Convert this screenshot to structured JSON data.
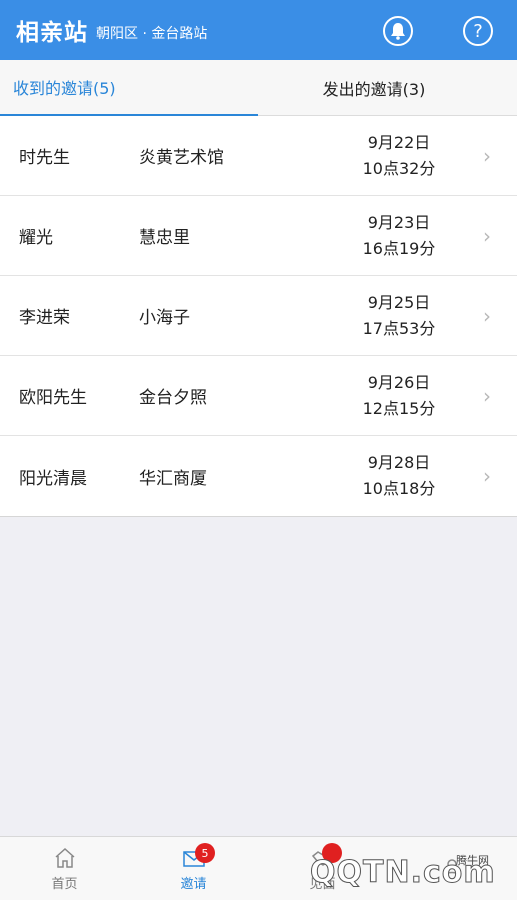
{
  "header": {
    "title": "相亲站",
    "location": "朝阳区 · 金台路站",
    "bell_icon": "bell-icon",
    "help_icon": "question-mark-icon",
    "help_glyph": "?"
  },
  "tabs": [
    {
      "label": "收到的邀请(5)",
      "active": true
    },
    {
      "label": "发出的邀请(3)",
      "active": false
    }
  ],
  "invitations": [
    {
      "name": "时先生",
      "place": "炎黄艺术馆",
      "date": "9月22日",
      "time": "10点32分"
    },
    {
      "name": "耀光",
      "place": "慧忠里",
      "date": "9月23日",
      "time": "16点19分"
    },
    {
      "name": "李进荣",
      "place": "小海子",
      "date": "9月25日",
      "time": "17点53分"
    },
    {
      "name": "欧阳先生",
      "place": "金台夕照",
      "date": "9月26日",
      "time": "12点15分"
    },
    {
      "name": "阳光清晨",
      "place": "华汇商厦",
      "date": "9月28日",
      "time": "10点18分"
    }
  ],
  "chevron_glyph": "›",
  "tabbar": {
    "items": [
      {
        "label": "首页",
        "icon": "home-icon"
      },
      {
        "label": "邀请",
        "icon": "envelope-icon",
        "badge": "5",
        "active": true
      },
      {
        "label": "见面",
        "icon": "handshake-icon"
      },
      {
        "label": "",
        "icon": "user-icon"
      }
    ]
  },
  "watermark": {
    "logo": "QQTN.com",
    "cn": "腾牛网"
  },
  "colors": {
    "header": "#3a8ee6",
    "accent": "#2a86d8",
    "badge": "#e02020"
  }
}
